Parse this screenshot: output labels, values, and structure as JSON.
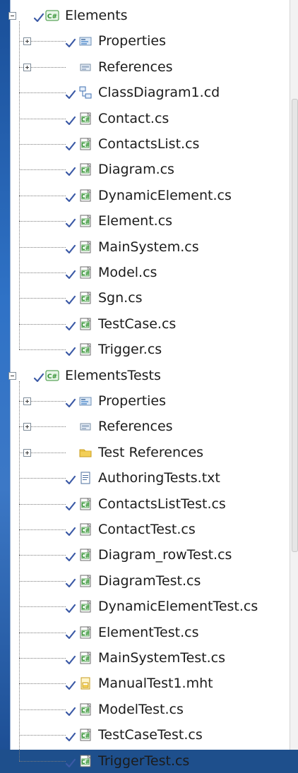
{
  "tree": {
    "rows": [
      {
        "level": 0,
        "kind": "project",
        "label": "Elements",
        "expander": "minus",
        "check": true
      },
      {
        "level": 1,
        "kind": "properties",
        "label": "Properties",
        "expander": "plus",
        "check": true
      },
      {
        "level": 1,
        "kind": "references",
        "label": "References",
        "expander": "plus",
        "check": false
      },
      {
        "level": 1,
        "kind": "diagram",
        "label": "ClassDiagram1.cd",
        "expander": "none",
        "check": true
      },
      {
        "level": 1,
        "kind": "cs",
        "label": "Contact.cs",
        "expander": "none",
        "check": true
      },
      {
        "level": 1,
        "kind": "cs",
        "label": "ContactsList.cs",
        "expander": "none",
        "check": true
      },
      {
        "level": 1,
        "kind": "cs",
        "label": "Diagram.cs",
        "expander": "none",
        "check": true
      },
      {
        "level": 1,
        "kind": "cs",
        "label": "DynamicElement.cs",
        "expander": "none",
        "check": true
      },
      {
        "level": 1,
        "kind": "cs",
        "label": "Element.cs",
        "expander": "none",
        "check": true
      },
      {
        "level": 1,
        "kind": "cs",
        "label": "MainSystem.cs",
        "expander": "none",
        "check": true
      },
      {
        "level": 1,
        "kind": "cs",
        "label": "Model.cs",
        "expander": "none",
        "check": true
      },
      {
        "level": 1,
        "kind": "cs",
        "label": "Sgn.cs",
        "expander": "none",
        "check": true
      },
      {
        "level": 1,
        "kind": "cs",
        "label": "TestCase.cs",
        "expander": "none",
        "check": true
      },
      {
        "level": 1,
        "kind": "cs",
        "label": "Trigger.cs",
        "expander": "none",
        "check": true
      },
      {
        "level": 0,
        "kind": "project",
        "label": "ElementsTests",
        "expander": "minus",
        "check": true
      },
      {
        "level": 1,
        "kind": "properties",
        "label": "Properties",
        "expander": "plus",
        "check": true
      },
      {
        "level": 1,
        "kind": "references",
        "label": "References",
        "expander": "plus",
        "check": false
      },
      {
        "level": 1,
        "kind": "folder",
        "label": "Test References",
        "expander": "plus",
        "check": false
      },
      {
        "level": 1,
        "kind": "txt",
        "label": "AuthoringTests.txt",
        "expander": "none",
        "check": true
      },
      {
        "level": 1,
        "kind": "cs",
        "label": "ContactsListTest.cs",
        "expander": "none",
        "check": true
      },
      {
        "level": 1,
        "kind": "cs",
        "label": "ContactTest.cs",
        "expander": "none",
        "check": true
      },
      {
        "level": 1,
        "kind": "cs",
        "label": "Diagram_rowTest.cs",
        "expander": "none",
        "check": true
      },
      {
        "level": 1,
        "kind": "cs",
        "label": "DiagramTest.cs",
        "expander": "none",
        "check": true
      },
      {
        "level": 1,
        "kind": "cs",
        "label": "DynamicElementTest.cs",
        "expander": "none",
        "check": true
      },
      {
        "level": 1,
        "kind": "cs",
        "label": "ElementTest.cs",
        "expander": "none",
        "check": true
      },
      {
        "level": 1,
        "kind": "cs",
        "label": "MainSystemTest.cs",
        "expander": "none",
        "check": true
      },
      {
        "level": 1,
        "kind": "mht",
        "label": "ManualTest1.mht",
        "expander": "none",
        "check": true
      },
      {
        "level": 1,
        "kind": "cs",
        "label": "ModelTest.cs",
        "expander": "none",
        "check": true
      },
      {
        "level": 1,
        "kind": "cs",
        "label": "TestCaseTest.cs",
        "expander": "none",
        "check": true
      },
      {
        "level": 1,
        "kind": "cs",
        "label": "TriggerTest.cs",
        "expander": "none",
        "check": true
      }
    ]
  },
  "colors": {
    "background": "#1e4f8c",
    "panel": "#ffffff",
    "check": "#3c5aa6",
    "cs_icon": "#2f8f2f"
  },
  "icons": {
    "project": "csharp-project-icon",
    "properties": "properties-folder-icon",
    "references": "references-icon",
    "diagram": "class-diagram-icon",
    "cs": "csharp-file-icon",
    "txt": "text-file-icon",
    "folder": "folder-icon",
    "mht": "mht-file-icon"
  }
}
